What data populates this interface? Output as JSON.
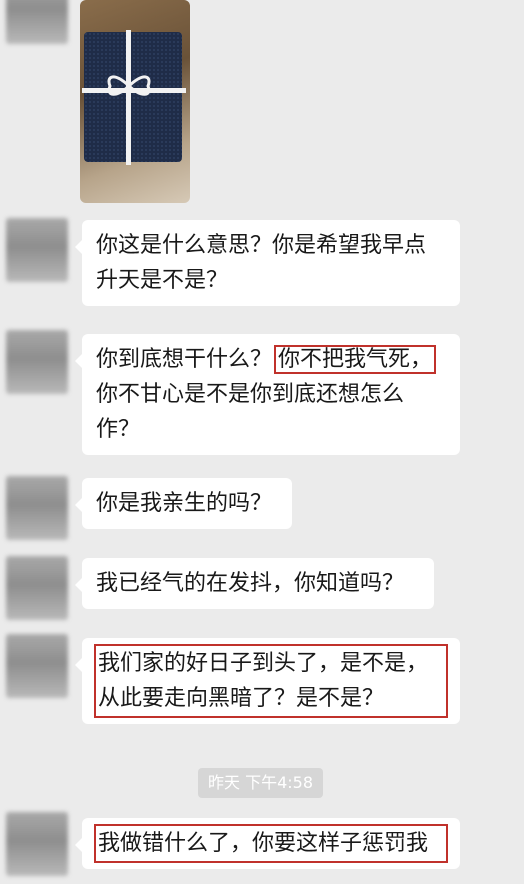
{
  "messages": [
    {
      "text": "你这是什么意思？你是希望我早点升天是不是？"
    },
    {
      "text_before": "你到底想干什么？",
      "highlight": "你不把我气死，",
      "text_after": "你不甘心是不是你到底还想怎么作？"
    },
    {
      "text": "你是我亲生的吗？"
    },
    {
      "text": "我已经气的在发抖，你知道吗？"
    },
    {
      "text": "我们家的好日子到头了，是不是，从此要走向黑暗了？是不是？"
    },
    {
      "text": "我做错什么了，你要这样子惩罚我"
    }
  ],
  "timestamp": "昨天 下午4:58",
  "colors": {
    "background": "#ebebeb",
    "bubble": "#ffffff",
    "highlight_border": "#c0312b"
  }
}
